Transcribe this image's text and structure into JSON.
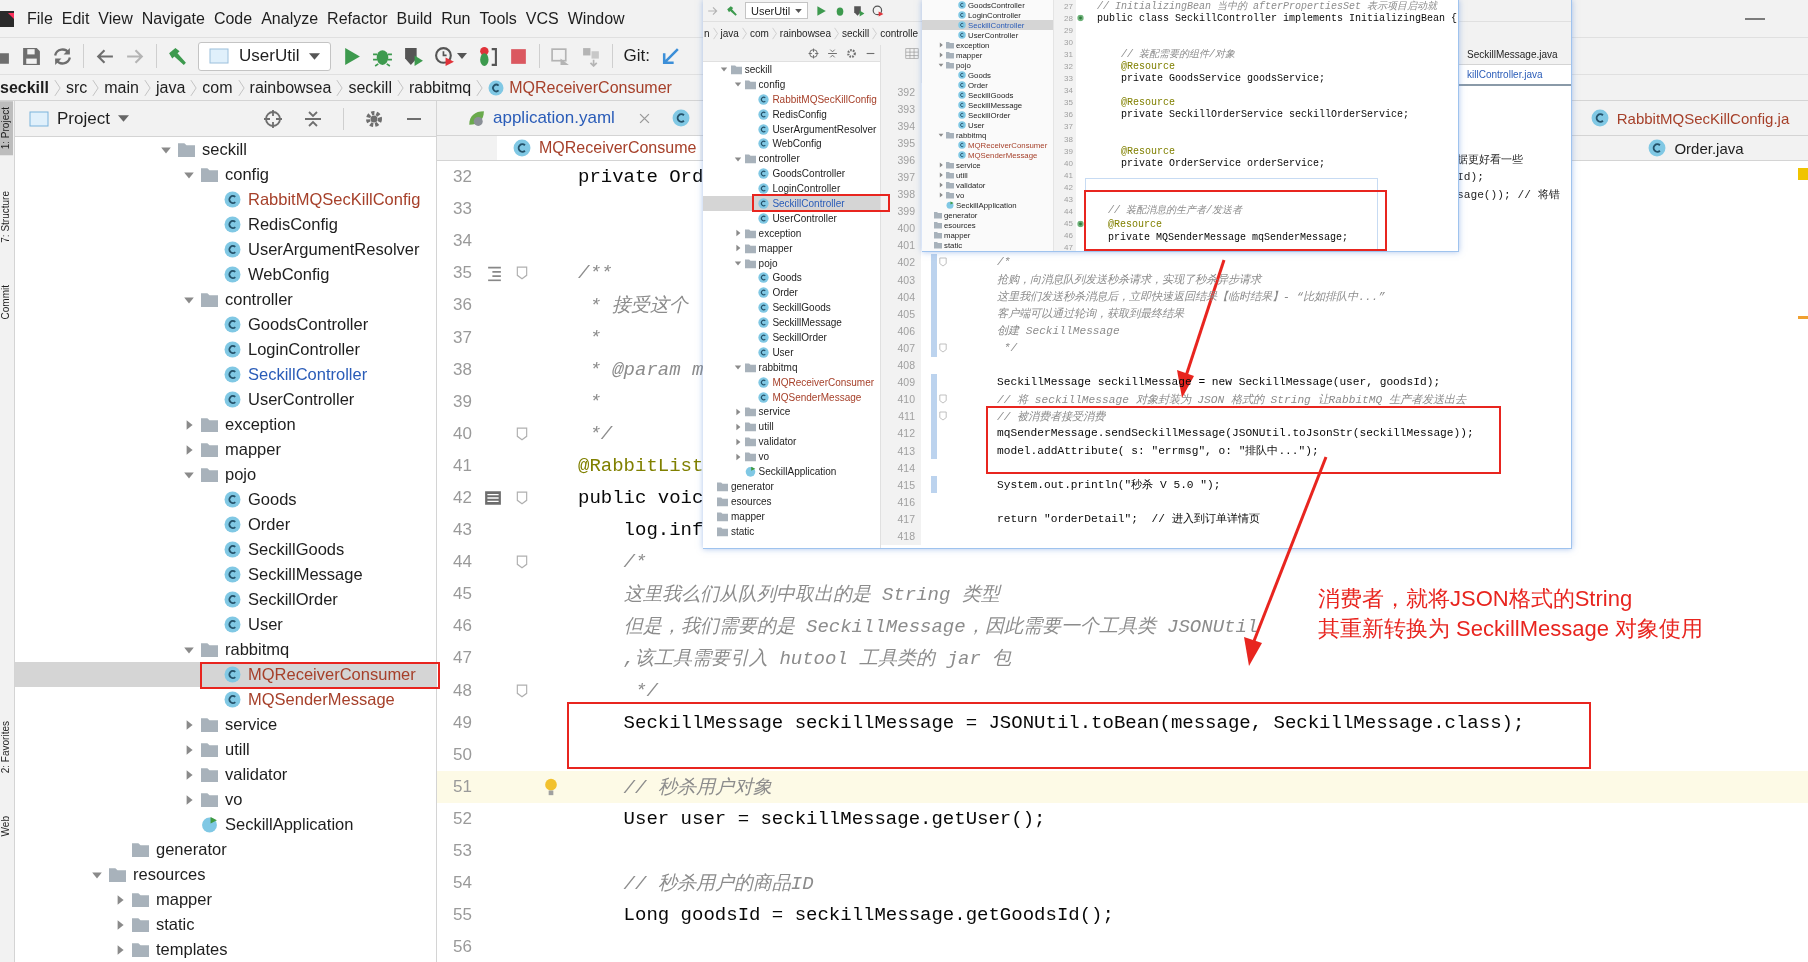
{
  "menu": [
    "File",
    "Edit",
    "View",
    "Navigate",
    "Code",
    "Analyze",
    "Refactor",
    "Build",
    "Run",
    "Tools",
    "VCS",
    "Window"
  ],
  "toolbar": {
    "run_config": "UserUtil",
    "git_label": "Git:"
  },
  "breadcrumbs": [
    {
      "label": "seckill",
      "kind": "module"
    },
    {
      "label": "src",
      "kind": "dir"
    },
    {
      "label": "main",
      "kind": "dir"
    },
    {
      "label": "java",
      "kind": "dir"
    },
    {
      "label": "com",
      "kind": "dir"
    },
    {
      "label": "rainbowsea",
      "kind": "dir"
    },
    {
      "label": "seckill",
      "kind": "dir"
    },
    {
      "label": "rabbitmq",
      "kind": "dir"
    },
    {
      "label": "MQReceiverConsumer",
      "kind": "class"
    }
  ],
  "side_tabs": {
    "top": [
      {
        "label": "1: Project",
        "selected": true
      },
      {
        "label": "7: Structure",
        "selected": false
      },
      {
        "label": "Commit",
        "selected": false
      }
    ],
    "bottom": [
      {
        "label": "2: Favorites",
        "selected": false
      },
      {
        "label": "Web",
        "selected": false
      }
    ]
  },
  "project": {
    "title": "Project",
    "tree": [
      {
        "children": [
          {
            "children": [
              {
                "children": [
                  {
                    "label": "seckill",
                    "kind": "folder",
                    "expanded": true,
                    "selected": false,
                    "children": [
                      {
                        "label": "config",
                        "kind": "folder",
                        "expanded": true,
                        "selected": false,
                        "children": [
                          {
                            "label": "RabbitMQSecKillConfig",
                            "kind": "class",
                            "added": true,
                            "modified": false,
                            "selected": false
                          },
                          {
                            "label": "RedisConfig",
                            "kind": "class",
                            "added": false,
                            "modified": false,
                            "selected": false
                          },
                          {
                            "label": "UserArgumentResolver",
                            "kind": "class",
                            "added": false,
                            "modified": false,
                            "selected": false
                          },
                          {
                            "label": "WebConfig",
                            "kind": "class",
                            "added": false,
                            "modified": false,
                            "selected": false
                          }
                        ]
                      },
                      {
                        "label": "controller",
                        "kind": "folder",
                        "expanded": true,
                        "selected": false,
                        "children": [
                          {
                            "label": "GoodsController",
                            "kind": "class",
                            "added": false,
                            "modified": false,
                            "selected": false
                          },
                          {
                            "label": "LoginController",
                            "kind": "class",
                            "added": false,
                            "modified": false,
                            "selected": false
                          },
                          {
                            "label": "SeckillController",
                            "kind": "class",
                            "added": false,
                            "modified": true,
                            "selected": false
                          },
                          {
                            "label": "UserController",
                            "kind": "class",
                            "added": false,
                            "modified": false,
                            "selected": false
                          }
                        ]
                      },
                      {
                        "label": "exception",
                        "kind": "folder",
                        "expanded": false,
                        "selected": false
                      },
                      {
                        "label": "mapper",
                        "kind": "folder",
                        "expanded": false,
                        "selected": false
                      },
                      {
                        "label": "pojo",
                        "kind": "folder",
                        "expanded": true,
                        "selected": false,
                        "children": [
                          {
                            "label": "Goods",
                            "kind": "class",
                            "added": false,
                            "modified": false,
                            "selected": false
                          },
                          {
                            "label": "Order",
                            "kind": "class",
                            "added": false,
                            "modified": false,
                            "selected": false
                          },
                          {
                            "label": "SeckillGoods",
                            "kind": "class",
                            "added": false,
                            "modified": false,
                            "selected": false
                          },
                          {
                            "label": "SeckillMessage",
                            "kind": "class",
                            "added": false,
                            "modified": false,
                            "selected": false
                          },
                          {
                            "label": "SeckillOrder",
                            "kind": "class",
                            "added": false,
                            "modified": false,
                            "selected": false
                          },
                          {
                            "label": "User",
                            "kind": "class",
                            "added": false,
                            "modified": false,
                            "selected": false
                          }
                        ]
                      },
                      {
                        "label": "rabbitmq",
                        "kind": "folder",
                        "expanded": true,
                        "selected": false,
                        "children": [
                          {
                            "label": "MQReceiverConsumer",
                            "kind": "class",
                            "added": true,
                            "modified": false,
                            "selected": true
                          },
                          {
                            "label": "MQSenderMessage",
                            "kind": "class",
                            "added": true,
                            "modified": false,
                            "selected": false
                          }
                        ]
                      },
                      {
                        "label": "service",
                        "kind": "folder",
                        "expanded": false,
                        "selected": false
                      },
                      {
                        "label": "utill",
                        "kind": "folder",
                        "expanded": false,
                        "selected": false
                      },
                      {
                        "label": "validator",
                        "kind": "folder",
                        "expanded": false,
                        "selected": false
                      },
                      {
                        "label": "vo",
                        "kind": "folder",
                        "expanded": false,
                        "selected": false
                      },
                      {
                        "label": "SeckillApplication",
                        "kind": "app",
                        "added": false,
                        "modified": false,
                        "selected": false
                      }
                    ]
                  }
                ]
              }
            ]
          },
          {
            "label": "generator",
            "kind": "folder",
            "selected": false
          }
        ]
      },
      {
        "label": "resources",
        "kind": "folder",
        "expanded": true,
        "selected": false,
        "children": [
          {
            "label": "mapper",
            "kind": "folder",
            "expanded": false,
            "selected": false
          },
          {
            "label": "static",
            "kind": "folder",
            "expanded": false,
            "selected": false
          },
          {
            "label": "templates",
            "kind": "folder",
            "expanded": false,
            "selected": false
          }
        ]
      }
    ]
  },
  "editor": {
    "tab_rows": [
      {
        "left": [
          {
            "label": "application.yaml",
            "kind": "yaml",
            "added": false,
            "modified": true,
            "selected": false,
            "closable": true
          },
          {
            "kind": "class",
            "selected": false
          }
        ],
        "right": [
          {
            "label": "RabbitMQSecKillConfig.ja",
            "kind": "class",
            "added": true,
            "modified": false,
            "selected": false
          }
        ]
      },
      {
        "left": [
          {
            "label": "MQReceiverConsume",
            "kind": "class",
            "added": true,
            "modified": false,
            "selected": true
          }
        ],
        "right": [
          {
            "label": "Order.java",
            "kind": "class",
            "added": false,
            "modified": false,
            "selected": false
          }
        ]
      }
    ],
    "lines": [
      {
        "num": "32",
        "text": "private Ord",
        "kind": "code",
        "current": false
      },
      {
        "num": "33",
        "current": false
      },
      {
        "num": "34",
        "current": false
      },
      {
        "num": "35",
        "text": "/**",
        "kind": "comment",
        "current": false,
        "marks": [
          {
            "kind": "doc"
          },
          {
            "kind": "fold"
          }
        ]
      },
      {
        "num": "36",
        "text": " * 接受这个",
        "kind": "comment",
        "current": false
      },
      {
        "num": "37",
        "text": " *",
        "kind": "comment",
        "current": false
      },
      {
        "num": "38",
        "text": " * @param m",
        "kind": "comment",
        "current": false
      },
      {
        "num": "39",
        "text": " *",
        "kind": "comment",
        "current": false
      },
      {
        "num": "40",
        "text": " */",
        "kind": "comment",
        "current": false,
        "marks": [
          {
            "kind": "fold"
          }
        ]
      },
      {
        "num": "41",
        "text": "@RabbitList",
        "kind": "annotation",
        "current": false
      },
      {
        "num": "42",
        "text": "public voic",
        "kind": "code",
        "current": false,
        "marks": [
          {
            "kind": "list"
          },
          {
            "kind": "fold"
          }
        ]
      },
      {
        "num": "43",
        "text": "    log.inf",
        "kind": "code",
        "current": false
      },
      {
        "num": "44",
        "text": "    /*",
        "kind": "comment",
        "current": false,
        "marks": [
          {
            "kind": "fold"
          }
        ]
      },
      {
        "num": "45",
        "text": "    这里我么们从队列中取出的是 String 类型",
        "kind": "comment",
        "current": false
      },
      {
        "num": "46",
        "text": "    但是，我们需要的是 SeckillMessage，因此需要一个工具类 JSONUtil",
        "kind": "comment",
        "current": false
      },
      {
        "num": "47",
        "text": "    ,该工具需要引入 hutool 工具类的 jar 包",
        "kind": "comment",
        "current": false
      },
      {
        "num": "48",
        "text": "     */",
        "kind": "comment",
        "current": false,
        "marks": [
          {
            "kind": "fold"
          }
        ]
      },
      {
        "num": "49",
        "text": "    SeckillMessage seckillMessage = JSONUtil.toBean(message, SeckillMessage.class);",
        "kind": "code",
        "current": false
      },
      {
        "num": "50",
        "current": false
      },
      {
        "num": "51",
        "text": "    // 秒杀用户对象",
        "kind": "comment",
        "current": true,
        "marks": [
          {
            "kind": "bulb"
          }
        ]
      },
      {
        "num": "52",
        "text": "    User user = seckillMessage.getUser();",
        "kind": "code",
        "current": false
      },
      {
        "num": "53",
        "current": false
      },
      {
        "num": "54",
        "text": "    // 秒杀用户的商品ID",
        "kind": "comment",
        "current": false
      },
      {
        "num": "55",
        "text": "    Long goodsId = seckillMessage.getGoodsId();",
        "kind": "code",
        "current": false
      },
      {
        "num": "56",
        "current": false
      }
    ]
  },
  "screenshot_1": {
    "run_config": "UserUtil",
    "breadcrumbs": [
      "n",
      "java",
      "com",
      "rainbowsea",
      "seckill",
      "controlle"
    ],
    "tree": [
      {
        "children": [
          {
            "label": "seckill",
            "kind": "folder",
            "expanded": true,
            "selected": false,
            "children": [
              {
                "label": "config",
                "kind": "folder",
                "expanded": true,
                "selected": false,
                "children": [
                  {
                    "label": "RabbitMQSecKillConfig",
                    "kind": "class",
                    "added": true,
                    "modified": false,
                    "selected": false
                  },
                  {
                    "label": "RedisConfig",
                    "kind": "class",
                    "added": false,
                    "modified": false,
                    "selected": false
                  },
                  {
                    "label": "UserArgumentResolver",
                    "kind": "class",
                    "added": false,
                    "modified": false,
                    "selected": false
                  },
                  {
                    "label": "WebConfig",
                    "kind": "class",
                    "added": false,
                    "modified": false,
                    "selected": false
                  }
                ]
              },
              {
                "label": "controller",
                "kind": "folder",
                "expanded": true,
                "selected": false,
                "children": [
                  {
                    "label": "GoodsController",
                    "kind": "class",
                    "added": false,
                    "modified": false,
                    "selected": false
                  },
                  {
                    "label": "LoginController",
                    "kind": "class",
                    "added": false,
                    "modified": false,
                    "selected": false
                  },
                  {
                    "label": "SeckillController",
                    "kind": "class",
                    "added": false,
                    "modified": true,
                    "selected": true
                  },
                  {
                    "label": "UserController",
                    "kind": "class",
                    "added": false,
                    "modified": false,
                    "selected": false
                  }
                ]
              },
              {
                "label": "exception",
                "kind": "folder",
                "expanded": false,
                "selected": false
              },
              {
                "label": "mapper",
                "kind": "folder",
                "expanded": false,
                "selected": false
              },
              {
                "label": "pojo",
                "kind": "folder",
                "expanded": true,
                "selected": false,
                "children": [
                  {
                    "label": "Goods",
                    "kind": "class",
                    "added": false,
                    "modified": false,
                    "selected": false
                  },
                  {
                    "label": "Order",
                    "kind": "class",
                    "added": false,
                    "modified": false,
                    "selected": false
                  },
                  {
                    "label": "SeckillGoods",
                    "kind": "class",
                    "added": false,
                    "modified": false,
                    "selected": false
                  },
                  {
                    "label": "SeckillMessage",
                    "kind": "class",
                    "added": false,
                    "modified": false,
                    "selected": false
                  },
                  {
                    "label": "SeckillOrder",
                    "kind": "class",
                    "added": false,
                    "modified": false,
                    "selected": false
                  },
                  {
                    "label": "User",
                    "kind": "class",
                    "added": false,
                    "modified": false,
                    "selected": false
                  }
                ]
              },
              {
                "label": "rabbitmq",
                "kind": "folder",
                "expanded": true,
                "selected": false,
                "children": [
                  {
                    "label": "MQReceiverConsumer",
                    "kind": "class",
                    "added": true,
                    "modified": false,
                    "selected": false
                  },
                  {
                    "label": "MQSenderMessage",
                    "kind": "class",
                    "added": true,
                    "modified": false,
                    "selected": false
                  }
                ]
              },
              {
                "label": "service",
                "kind": "folder",
                "expanded": false,
                "selected": false
              },
              {
                "label": "utill",
                "kind": "folder",
                "expanded": false,
                "selected": false
              },
              {
                "label": "validator",
                "kind": "folder",
                "expanded": false,
                "selected": false
              },
              {
                "label": "vo",
                "kind": "folder",
                "expanded": false,
                "selected": false
              },
              {
                "label": "SeckillApplication",
                "kind": "app",
                "added": false,
                "modified": false,
                "selected": false
              }
            ]
          }
        ]
      },
      {
        "label": "generator",
        "kind": "folder",
        "selected": false
      },
      {
        "label": "esources",
        "kind": "folder",
        "selected": false
      },
      {
        "label": "mapper",
        "kind": "folder",
        "selected": false
      },
      {
        "label": "static",
        "kind": "folder",
        "selected": false
      }
    ],
    "tabs": [
      {
        "label": "SeckillMessage.java",
        "selected": false
      },
      {
        "label": "killController.java",
        "selected": true
      }
    ],
    "lines": [
      {
        "num": "392",
        "changed": false
      },
      {
        "num": "393",
        "changed": false
      },
      {
        "num": "394",
        "changed": false
      },
      {
        "num": "395",
        "changed": false
      },
      {
        "num": "396",
        "changed": false,
        "tail": "据更好看一些"
      },
      {
        "num": "397",
        "changed": false,
        "tail": "Id);"
      },
      {
        "num": "398",
        "changed": false,
        "tail": "sage()); // 将错"
      },
      {
        "num": "399",
        "changed": false
      },
      {
        "num": "400",
        "changed": false
      },
      {
        "num": "401",
        "changed": false
      },
      {
        "num": "402",
        "text": "/*",
        "kind": "comment",
        "changed": true,
        "marks": [
          {
            "kind": "fold"
          }
        ]
      },
      {
        "num": "403",
        "text": "抢购，向消息队列发送秒杀请求，实现了秒杀异步请求",
        "kind": "comment",
        "changed": true
      },
      {
        "num": "404",
        "text": "这里我们发送秒杀消息后，立即快速返回结果【临时结果】- “比如排队中...”",
        "kind": "comment",
        "changed": true
      },
      {
        "num": "405",
        "text": "客户端可以通过轮询，获取到最终结果",
        "kind": "comment",
        "changed": true
      },
      {
        "num": "406",
        "text": "创建 SeckillMessage",
        "kind": "comment",
        "changed": true
      },
      {
        "num": "407",
        "text": " */",
        "kind": "comment",
        "changed": true,
        "marks": [
          {
            "kind": "fold"
          }
        ]
      },
      {
        "num": "408",
        "changed": false
      },
      {
        "num": "409",
        "text": "SeckillMessage seckillMessage = new SeckillMessage(user, goodsId);",
        "kind": "code",
        "changed": true
      },
      {
        "num": "410",
        "text": "// 将 seckillMessage 对象封装为 JSON 格式的 String 让RabbitMQ 生产者发送出去",
        "kind": "comment",
        "changed": true,
        "marks": [
          {
            "kind": "fold"
          }
        ]
      },
      {
        "num": "411",
        "text": "// 被消费者接受消费",
        "kind": "comment",
        "changed": true,
        "marks": [
          {
            "kind": "fold"
          }
        ]
      },
      {
        "num": "412",
        "text": "mqSenderMessage.sendSeckillMessage(JSONUtil.toJsonStr(seckillMessage));",
        "kind": "code",
        "changed": true
      },
      {
        "num": "413",
        "text": "model.addAttribute( s: \"errmsg\", o: \"排队中...\");",
        "kind": "code",
        "changed": true
      },
      {
        "num": "414",
        "changed": false
      },
      {
        "num": "415",
        "text": "System.out.println(\"秒杀 V 5.0 \");",
        "kind": "code",
        "changed": true
      },
      {
        "num": "416",
        "changed": false
      },
      {
        "num": "417",
        "text": "return \"orderDetail\";  // 进入到订单详情页",
        "kind": "code",
        "changed": false
      },
      {
        "num": "418",
        "changed": false
      }
    ]
  },
  "screenshot_2": {
    "tree": [
      {
        "children": [
          {
            "children": [
              {
                "label": "GoodsController",
                "kind": "class",
                "added": false,
                "modified": false,
                "selected": false
              },
              {
                "label": "LoginController",
                "kind": "class",
                "added": false,
                "modified": false,
                "selected": false
              },
              {
                "label": "SeckillController",
                "kind": "class",
                "added": false,
                "modified": true,
                "selected": true
              },
              {
                "label": "UserController",
                "kind": "class",
                "added": false,
                "modified": false,
                "selected": false
              }
            ]
          },
          {
            "label": "exception",
            "kind": "folder",
            "expanded": false,
            "selected": false
          },
          {
            "label": "mapper",
            "kind": "folder",
            "expanded": false,
            "selected": false
          },
          {
            "label": "pojo",
            "kind": "folder",
            "expanded": true,
            "selected": false,
            "children": [
              {
                "label": "Goods",
                "kind": "class",
                "added": false,
                "modified": false,
                "selected": false
              },
              {
                "label": "Order",
                "kind": "class",
                "added": false,
                "modified": false,
                "selected": false
              },
              {
                "label": "SeckillGoods",
                "kind": "class",
                "added": false,
                "modified": false,
                "selected": false
              },
              {
                "label": "SeckillMessage",
                "kind": "class",
                "added": false,
                "modified": false,
                "selected": false
              },
              {
                "label": "SeckillOrder",
                "kind": "class",
                "added": false,
                "modified": false,
                "selected": false
              },
              {
                "label": "User",
                "kind": "class",
                "added": false,
                "modified": false,
                "selected": false
              }
            ]
          },
          {
            "label": "rabbitmq",
            "kind": "folder",
            "expanded": true,
            "selected": false,
            "children": [
              {
                "label": "MQReceiverConsumer",
                "kind": "class",
                "added": true,
                "modified": false,
                "selected": false
              },
              {
                "label": "MQSenderMessage",
                "kind": "class",
                "added": true,
                "modified": false,
                "selected": false
              }
            ]
          },
          {
            "label": "service",
            "kind": "folder",
            "expanded": false,
            "selected": false
          },
          {
            "label": "utill",
            "kind": "folder",
            "expanded": false,
            "selected": false
          },
          {
            "label": "validator",
            "kind": "folder",
            "expanded": false,
            "selected": false
          },
          {
            "label": "vo",
            "kind": "folder",
            "expanded": false,
            "selected": false
          },
          {
            "label": "SeckillApplication",
            "kind": "app",
            "added": false,
            "modified": false,
            "selected": false
          }
        ]
      },
      {
        "label": "generator",
        "kind": "folder",
        "selected": false
      },
      {
        "label": "esources",
        "kind": "folder",
        "selected": false
      },
      {
        "label": "mapper",
        "kind": "folder",
        "selected": false
      },
      {
        "label": "static",
        "kind": "folder",
        "selected": false
      }
    ],
    "lines": [
      {
        "num": "27",
        "text": "// InitializingBean 当中的 afterPropertiesSet 表示项目启动就",
        "kind": "comment"
      },
      {
        "num": "28",
        "text": "public class SeckillController implements InitializingBean {",
        "kind": "code",
        "marks": [
          {
            "kind": "bean"
          }
        ]
      },
      {
        "num": "29"
      },
      {
        "num": "30"
      },
      {
        "num": "31",
        "text": "    // 装配需要的组件/对象",
        "kind": "comment"
      },
      {
        "num": "32",
        "text": "    @Resource",
        "kind": "annotation"
      },
      {
        "num": "33",
        "text": "    private GoodsService goodsService;",
        "kind": "code"
      },
      {
        "num": "34"
      },
      {
        "num": "35",
        "text": "    @Resource",
        "kind": "annotation"
      },
      {
        "num": "36",
        "text": "    private SeckillOrderService seckillOrderService;",
        "kind": "code"
      },
      {
        "num": "37"
      },
      {
        "num": "38"
      },
      {
        "num": "39",
        "text": "    @Resource",
        "kind": "annotation"
      },
      {
        "num": "40",
        "text": "    private OrderService orderService;",
        "kind": "code"
      },
      {
        "num": "41"
      },
      {
        "num": "42"
      },
      {
        "num": "43"
      },
      {
        "num": "44"
      },
      {
        "num": "45",
        "marks": [
          {
            "kind": "bean"
          }
        ]
      },
      {
        "num": "46"
      },
      {
        "num": "47"
      }
    ],
    "popup": {
      "lines": [
        {
          "text": "// 装配消息的生产者/发送者",
          "kind": "comment"
        },
        {
          "text": "@Resource",
          "kind": "annotation"
        },
        {
          "text": "private MQSenderMessage mqSenderMessage;",
          "kind": "code"
        }
      ]
    }
  },
  "annotation": {
    "lines": [
      "消费者，就将JSON格式的String",
      "其重新转换为 SeckillMessage 对象使用"
    ]
  }
}
